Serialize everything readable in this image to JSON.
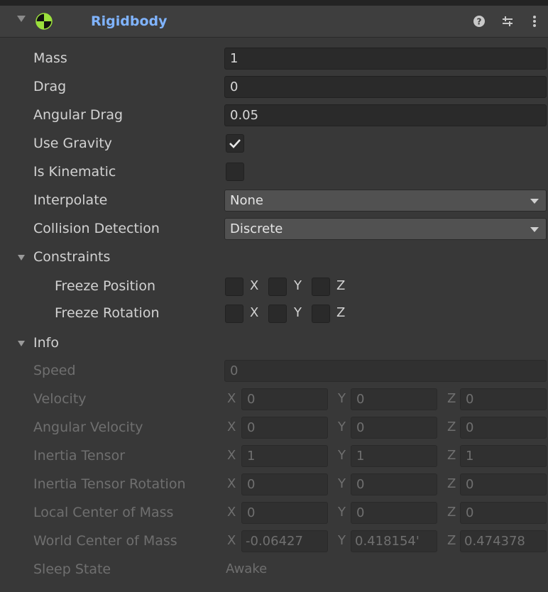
{
  "component": {
    "title": "Rigidbody",
    "icons": [
      "foldout-arrow-icon",
      "rigidbody-icon",
      "help-icon",
      "presets-icon",
      "more-options-icon"
    ]
  },
  "properties": {
    "mass": {
      "label": "Mass",
      "value": "1"
    },
    "drag": {
      "label": "Drag",
      "value": "0"
    },
    "angular_drag": {
      "label": "Angular Drag",
      "value": "0.05"
    },
    "use_gravity": {
      "label": "Use Gravity",
      "checked": true
    },
    "is_kinematic": {
      "label": "Is Kinematic",
      "checked": false
    },
    "interpolate": {
      "label": "Interpolate",
      "value": "None"
    },
    "collision_detection": {
      "label": "Collision Detection",
      "value": "Discrete"
    }
  },
  "constraints": {
    "label": "Constraints",
    "freeze_position": {
      "label": "Freeze Position",
      "x": "X",
      "y": "Y",
      "z": "Z",
      "checked": [
        false,
        false,
        false
      ]
    },
    "freeze_rotation": {
      "label": "Freeze Rotation",
      "x": "X",
      "y": "Y",
      "z": "Z",
      "checked": [
        false,
        false,
        false
      ]
    }
  },
  "info": {
    "label": "Info",
    "axes": {
      "x": "X",
      "y": "Y",
      "z": "Z"
    },
    "speed": {
      "label": "Speed",
      "value": "0"
    },
    "velocity": {
      "label": "Velocity",
      "x": "0",
      "y": "0",
      "z": "0"
    },
    "angular_velocity": {
      "label": "Angular Velocity",
      "x": "0",
      "y": "0",
      "z": "0"
    },
    "inertia_tensor": {
      "label": "Inertia Tensor",
      "x": "1",
      "y": "1",
      "z": "1"
    },
    "inertia_tensor_rotation": {
      "label": "Inertia Tensor Rotation",
      "x": "0",
      "y": "0",
      "z": "0"
    },
    "local_center_of_mass": {
      "label": "Local Center of Mass",
      "x": "0",
      "y": "0",
      "z": "0"
    },
    "world_center_of_mass": {
      "label": "World Center of Mass",
      "x": "-0.06427",
      "y": "0.418154'",
      "z": "0.474378"
    },
    "sleep_state": {
      "label": "Sleep State",
      "value": "Awake"
    }
  },
  "colors": {
    "background": "#383838",
    "header": "#3e3e3e",
    "title": "#80b4ff",
    "field": "#2a2a2a",
    "dropdown": "#515151",
    "disabled_text": "#6f6f6f"
  }
}
